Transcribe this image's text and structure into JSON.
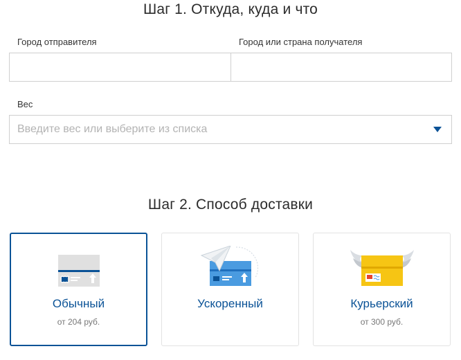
{
  "step1": {
    "title": "Шаг 1. Откуда, куда и что",
    "sender_city_label": "Город отправителя",
    "sender_city_value": "",
    "recipient_label": "Город или страна получателя",
    "recipient_value": "",
    "weight_label": "Вес",
    "weight_placeholder": "Введите вес или выберите из списка"
  },
  "step2": {
    "title": "Шаг 2. Способ доставки",
    "options": [
      {
        "title": "Обычный",
        "price": "от 204 руб.",
        "icon": "regular-envelope-icon",
        "selected": true
      },
      {
        "title": "Ускоренный",
        "price": "",
        "icon": "express-envelope-plane-icon",
        "selected": false
      },
      {
        "title": "Курьерский",
        "price": "от 300 руб.",
        "icon": "courier-winged-envelope-icon",
        "selected": false
      }
    ]
  },
  "colors": {
    "accent": "#0a5296",
    "express_blue": "#4a9be0",
    "courier_yellow": "#f6c514",
    "regular_gray": "#e0e0e0"
  }
}
